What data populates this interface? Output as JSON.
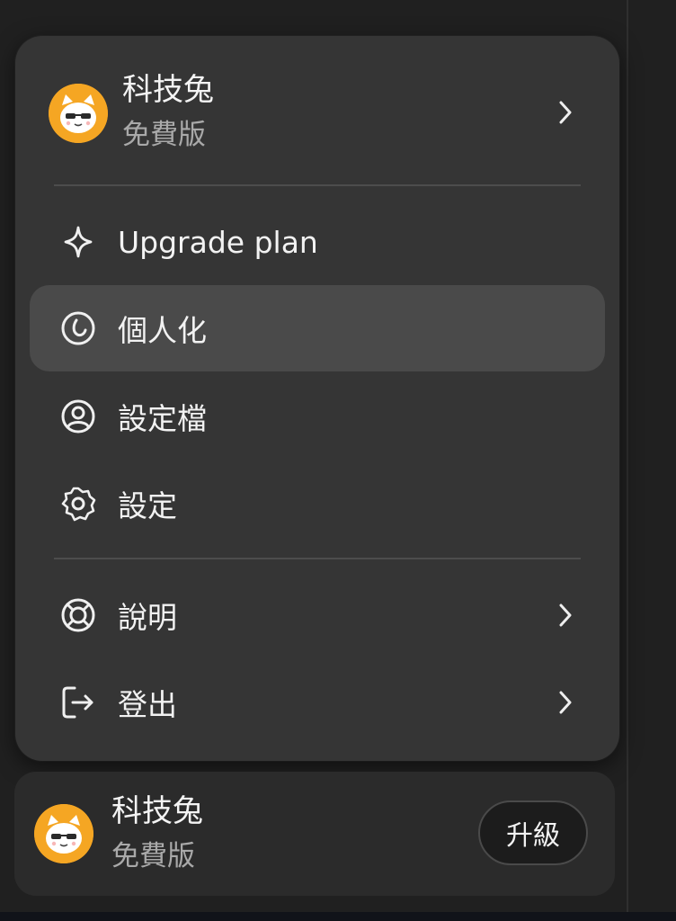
{
  "profile": {
    "name": "科技兔",
    "plan": "免費版",
    "avatar_icon": "cat-avatar-icon",
    "avatar_color": "#f5a623"
  },
  "menu": {
    "items": [
      {
        "label": "Upgrade plan",
        "icon": "sparkle-icon"
      },
      {
        "label": "個人化",
        "icon": "personalize-icon",
        "active": true
      },
      {
        "label": "設定檔",
        "icon": "user-circle-icon"
      },
      {
        "label": "設定",
        "icon": "gear-icon"
      }
    ],
    "secondary_items": [
      {
        "label": "說明",
        "icon": "lifebuoy-icon",
        "has_submenu": true
      },
      {
        "label": "登出",
        "icon": "logout-icon",
        "has_submenu": true
      }
    ]
  },
  "footer": {
    "name": "科技兔",
    "plan": "免費版",
    "upgrade_label": "升級"
  },
  "colors": {
    "menu_bg": "#353535",
    "active_item_bg": "#4a4a4a",
    "text_primary": "#f2f2f2",
    "text_secondary": "#a9a9a9"
  }
}
